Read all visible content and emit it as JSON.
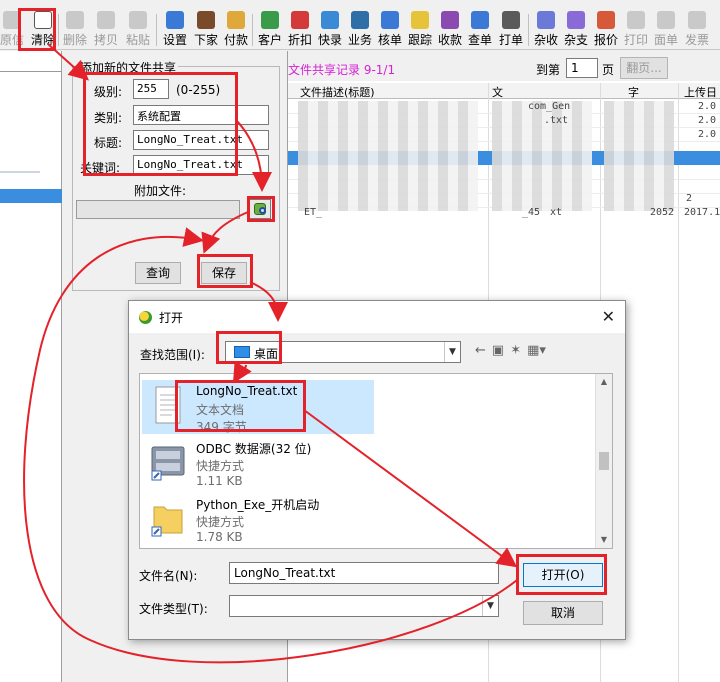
{
  "colors": {
    "annotation_red": "#e3222a",
    "record_title": "#d61fd6",
    "selection_blue": "#3b8de0",
    "list_selected": "#cce8ff"
  },
  "toolbar": {
    "items": [
      {
        "label": "原信",
        "icon": "original-icon",
        "enabled": false
      },
      {
        "label": "清除",
        "icon": "new-document-icon",
        "enabled": true
      },
      {
        "label": "删除",
        "icon": "delete-icon",
        "enabled": false
      },
      {
        "label": "拷贝",
        "icon": "copy-icon",
        "enabled": false
      },
      {
        "label": "粘贴",
        "icon": "paste-icon",
        "enabled": false
      },
      {
        "label": "设置",
        "icon": "settings-icon",
        "enabled": true
      },
      {
        "label": "下家",
        "icon": "downstream-icon",
        "enabled": true
      },
      {
        "label": "付款",
        "icon": "payment-icon",
        "enabled": true
      },
      {
        "label": "客户",
        "icon": "customer-icon",
        "enabled": true
      },
      {
        "label": "折扣",
        "icon": "discount-icon",
        "enabled": true
      },
      {
        "label": "快录",
        "icon": "quick-entry-icon",
        "enabled": true
      },
      {
        "label": "业务",
        "icon": "business-icon",
        "enabled": true
      },
      {
        "label": "核单",
        "icon": "verify-icon",
        "enabled": true
      },
      {
        "label": "跟踪",
        "icon": "track-icon",
        "enabled": true
      },
      {
        "label": "收款",
        "icon": "receive-icon",
        "enabled": true
      },
      {
        "label": "查单",
        "icon": "search-order-icon",
        "enabled": true
      },
      {
        "label": "打单",
        "icon": "print-order-icon",
        "enabled": true
      },
      {
        "label": "杂收",
        "icon": "misc-income-icon",
        "enabled": true
      },
      {
        "label": "杂支",
        "icon": "misc-expense-icon",
        "enabled": true
      },
      {
        "label": "报价",
        "icon": "quote-icon",
        "enabled": true
      },
      {
        "label": "打印",
        "icon": "print-icon",
        "enabled": false
      },
      {
        "label": "面单",
        "icon": "waybill-icon",
        "enabled": false
      },
      {
        "label": "发票",
        "icon": "invoice-icon",
        "enabled": false
      }
    ]
  },
  "share_form": {
    "title": "添加新的文件共享",
    "level_label": "级别:",
    "level_value": "255",
    "level_range": "(0-255)",
    "category_label": "类别:",
    "category_value": "系统配置",
    "title_label": "标题:",
    "title_value": "LongNo_Treat.txt",
    "keyword_label": "关键词:",
    "keyword_value": "LongNo_Treat.txt",
    "attach_label": "附加文件:",
    "query_button": "查询",
    "save_button": "保存"
  },
  "records": {
    "title": "文件共享记录 9-1/1",
    "goto_label": "到第",
    "page_value": "1",
    "page_suffix": "页",
    "flip_button": "翻页...",
    "columns": [
      "文件描述(标题)",
      "文",
      "字",
      "上传日"
    ],
    "fragments": [
      "com_Gen",
      "2.0",
      ".txt",
      "2.0",
      "2.0",
      "2052",
      "2017.1",
      "ET_",
      "_45",
      "xt",
      "2"
    ]
  },
  "open_dialog": {
    "title": "打开",
    "close_glyph": "✕",
    "lookin_label": "查找范围(I):",
    "lookin_value": "桌面",
    "files": [
      {
        "name": "LongNo_Treat.txt",
        "type": "文本文档",
        "size": "349 字节",
        "icon": "text-file-icon",
        "selected": true
      },
      {
        "name": "ODBC 数据源(32 位)",
        "type": "快捷方式",
        "size": "1.11 KB",
        "icon": "odbc-shortcut-icon",
        "selected": false
      },
      {
        "name": "Python_Exe_开机启动",
        "type": "快捷方式",
        "size": "1.78 KB",
        "icon": "folder-shortcut-icon",
        "selected": false
      }
    ],
    "filename_label": "文件名(N):",
    "filename_value": "LongNo_Treat.txt",
    "filetype_label": "文件类型(T):",
    "filetype_value": "",
    "open_button": "打开(O)",
    "cancel_button": "取消"
  }
}
